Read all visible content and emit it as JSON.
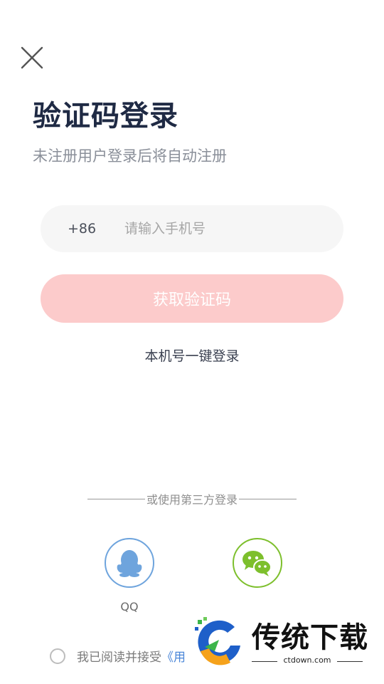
{
  "header": {
    "close_icon": "close-icon",
    "title": "验证码登录",
    "subtitle": "未注册用户登录后将自动注册"
  },
  "phone": {
    "country_code": "+86",
    "placeholder": "请输入手机号",
    "value": ""
  },
  "actions": {
    "get_code_label": "获取验证码",
    "one_click_label": "本机号一键登录"
  },
  "third_party": {
    "divider_label": "或使用第三方登录",
    "qq_label": "QQ",
    "qq_icon": "qq-penguin-icon",
    "wechat_icon": "wechat-icon"
  },
  "agreement": {
    "text": "我已阅读并接受",
    "link_text": "《用"
  },
  "watermark": {
    "brand": "传统下载",
    "domain": "ctdown.com"
  },
  "colors": {
    "primary_disabled": "#fccbcb",
    "qq_blue": "#6ea4dd",
    "wechat_green": "#7dbf2c",
    "title": "#1f2a44"
  }
}
